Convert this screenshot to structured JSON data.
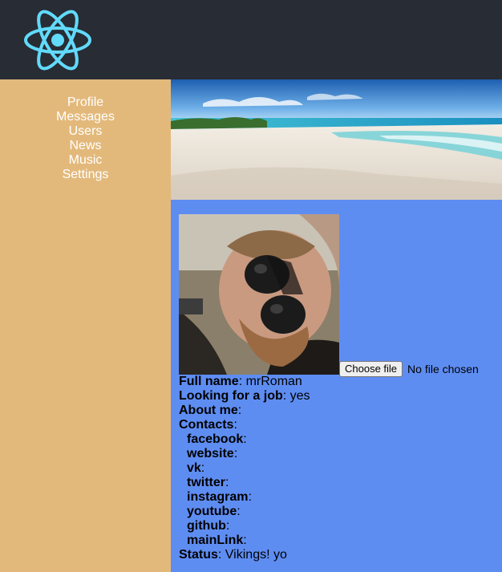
{
  "nav": {
    "items": [
      {
        "label": "Profile"
      },
      {
        "label": "Messages"
      },
      {
        "label": "Users"
      },
      {
        "label": "News"
      },
      {
        "label": "Music"
      },
      {
        "label": "Settings"
      }
    ]
  },
  "profile": {
    "file_button": "Choose file",
    "file_status": "No file chosen",
    "full_name_label": "Full name",
    "full_name": "mrRoman",
    "job_label": "Looking for a job",
    "job_value": "yes",
    "about_label": "About me",
    "about_value": "",
    "contacts_label": "Contacts",
    "contacts": [
      {
        "label": "facebook",
        "value": ""
      },
      {
        "label": "website",
        "value": ""
      },
      {
        "label": "vk",
        "value": ""
      },
      {
        "label": "twitter",
        "value": ""
      },
      {
        "label": "instagram",
        "value": ""
      },
      {
        "label": "youtube",
        "value": ""
      },
      {
        "label": "github",
        "value": ""
      },
      {
        "label": "mainLink",
        "value": ""
      }
    ],
    "status_label": "Status",
    "status": "Vikings! yo"
  },
  "colors": {
    "header_bg": "#282c34",
    "sidebar_bg": "#e3b97b",
    "content_bg": "#5e8df2",
    "logo": "#61dafb"
  },
  "icons": {
    "logo": "react-logo-icon"
  }
}
